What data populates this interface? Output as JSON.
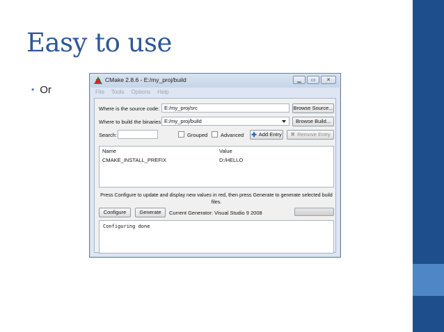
{
  "slide": {
    "title": "Easy to use",
    "bullet_text": "Or",
    "colors": {
      "title": "#2b5797",
      "sidebar_dark": "#1f4e8c",
      "sidebar_light": "#4f86c6"
    }
  },
  "window": {
    "title": "CMake 2.8.6 - E:/my_proj/build",
    "icon": "cmake-logo-icon",
    "controls": {
      "minimize": "minimize-icon",
      "maximize": "maximize-icon",
      "close": "close-icon"
    },
    "menu": [
      "File",
      "Tools",
      "Options",
      "Help"
    ]
  },
  "form": {
    "source_label": "Where is the source code:",
    "source_value": "E:/my_proj/src",
    "browse_source": "Browse Source...",
    "build_label": "Where to build the binaries:",
    "build_value": "E:/my_proj/build",
    "browse_build": "Browse Build...",
    "search_label": "Search:",
    "search_value": "",
    "grouped_label": "Grouped",
    "advanced_label": "Advanced",
    "add_entry": "Add Entry",
    "remove_entry": "Remove Entry"
  },
  "table": {
    "columns": [
      "Name",
      "Value"
    ],
    "rows": [
      {
        "name": "CMAKE_INSTALL_PREFIX",
        "value": "D:/HELLO"
      }
    ]
  },
  "info_line1": "Press Configure to update and display new values in red, then press Generate to generate selected build",
  "info_line2": "files.",
  "actions": {
    "configure": "Configure",
    "generate": "Generate",
    "current_generator": "Current Generator: Visual Studio 9 2008"
  },
  "output": "Configuring done"
}
